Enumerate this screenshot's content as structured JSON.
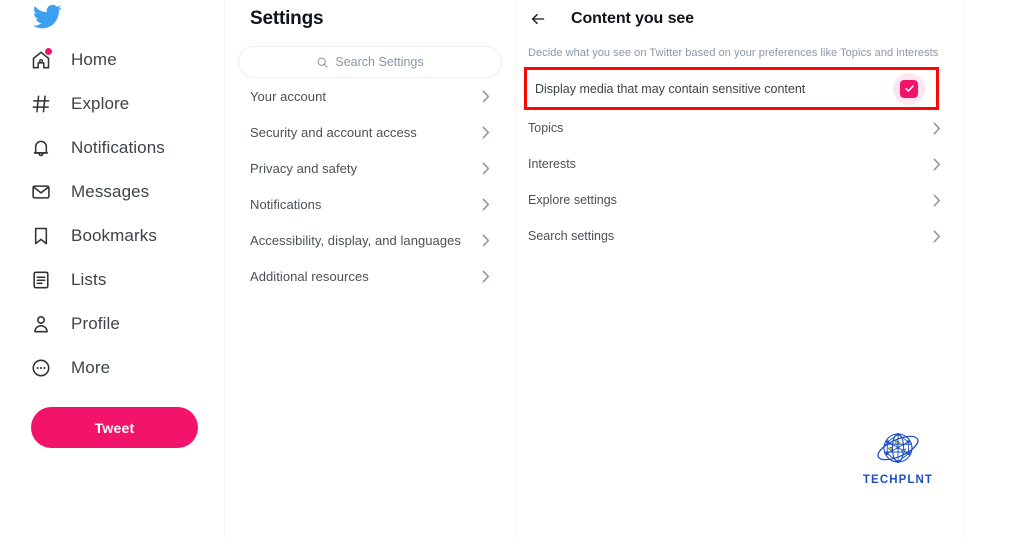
{
  "colors": {
    "brand_pink": "#f2136b",
    "twitter_blue": "#3ba0ef",
    "highlight_red": "#fb0505",
    "logo_blue": "#1f4fc4",
    "text_primary": "#0f1419",
    "text_secondary": "#4a5157",
    "text_muted": "#8b98a5"
  },
  "sidebar": {
    "logo_icon": "twitter-bird-icon",
    "items": [
      {
        "label": "Home",
        "icon": "home-icon",
        "badge": true
      },
      {
        "label": "Explore",
        "icon": "hashtag-icon",
        "badge": false
      },
      {
        "label": "Notifications",
        "icon": "bell-icon",
        "badge": false
      },
      {
        "label": "Messages",
        "icon": "envelope-icon",
        "badge": false
      },
      {
        "label": "Bookmarks",
        "icon": "bookmark-icon",
        "badge": false
      },
      {
        "label": "Lists",
        "icon": "list-icon",
        "badge": false
      },
      {
        "label": "Profile",
        "icon": "person-icon",
        "badge": false
      },
      {
        "label": "More",
        "icon": "more-circle-icon",
        "badge": false
      }
    ],
    "tweet_button": "Tweet"
  },
  "settings": {
    "title": "Settings",
    "search": {
      "placeholder": "Search Settings",
      "value": "",
      "icon": "search-icon"
    },
    "items": [
      {
        "label": "Your account",
        "chevron": "chevron-right-icon"
      },
      {
        "label": "Security and account access",
        "chevron": "chevron-right-icon"
      },
      {
        "label": "Privacy and safety",
        "chevron": "chevron-right-icon"
      },
      {
        "label": "Notifications",
        "chevron": "chevron-right-icon"
      },
      {
        "label": "Accessibility, display, and languages",
        "chevron": "chevron-right-icon"
      },
      {
        "label": "Additional resources",
        "chevron": "chevron-right-icon"
      }
    ]
  },
  "detail": {
    "back_icon": "back-arrow-icon",
    "title": "Content you see",
    "description": "Decide what you see on Twitter based on your preferences like Topics and interests",
    "toggle_row": {
      "label": "Display media that may contain sensitive content",
      "checked": true,
      "checkbox_icon": "checkmark-icon",
      "highlighted": true
    },
    "items": [
      {
        "label": "Topics",
        "chevron": "chevron-right-icon"
      },
      {
        "label": "Interests",
        "chevron": "chevron-right-icon"
      },
      {
        "label": "Explore settings",
        "chevron": "chevron-right-icon"
      },
      {
        "label": "Search settings",
        "chevron": "chevron-right-icon"
      }
    ]
  },
  "watermark": {
    "icon": "globe-network-icon",
    "text": "TECHPLNT"
  }
}
